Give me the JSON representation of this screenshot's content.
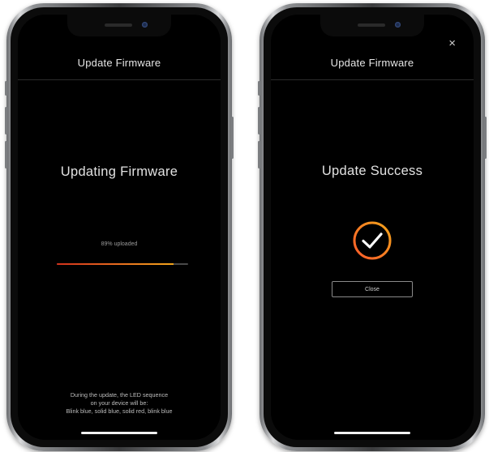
{
  "left_screen": {
    "header_title": "Update Firmware",
    "heading": "Updating Firmware",
    "progress": {
      "label": "89% uploaded",
      "fraction": 0.89,
      "colors": [
        "#d2321c",
        "#e76a1f",
        "#f2a51b"
      ]
    },
    "footer_lines": [
      "During the update, the LED sequence",
      "on your device will be:",
      "Blink blue, solid blue, solid red, blink blue"
    ]
  },
  "right_screen": {
    "header_title": "Update Firmware",
    "close_icon": "×",
    "heading": "Update Success",
    "success_icon": "check-circle-icon",
    "success_ring_colors": [
      "#ff5a2a",
      "#f2a51b"
    ],
    "close_button_label": "Close"
  }
}
